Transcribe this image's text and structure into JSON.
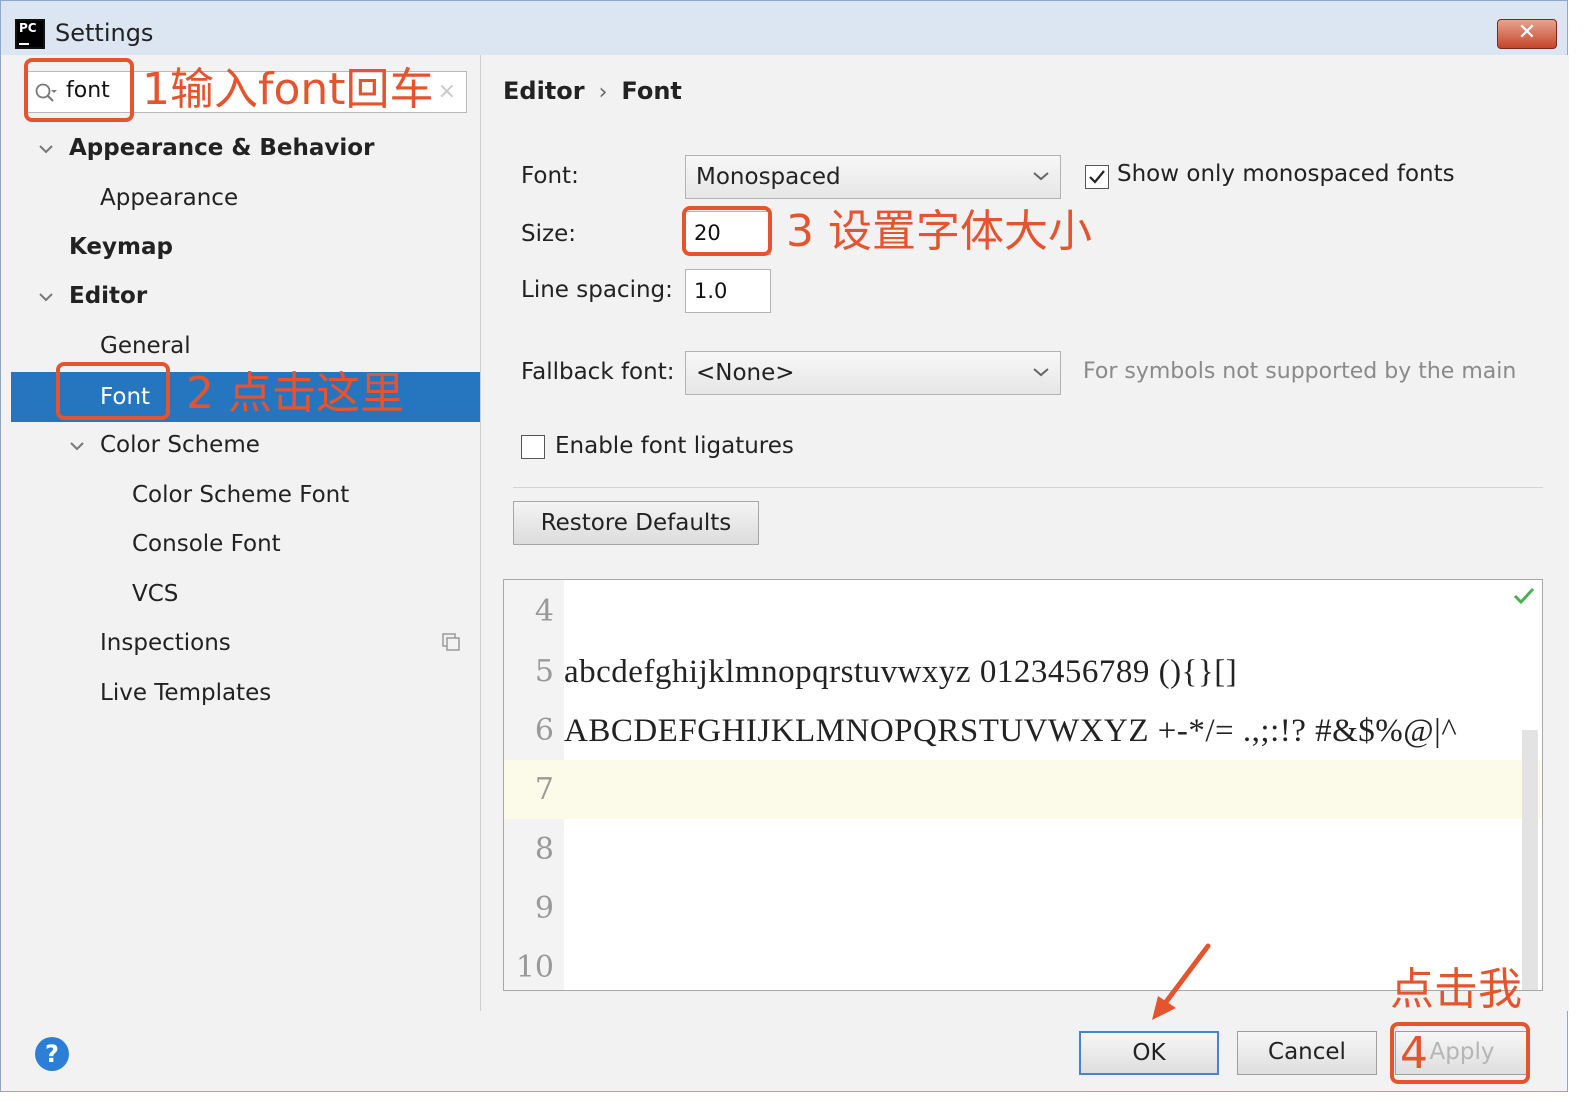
{
  "window": {
    "title": "Settings",
    "app_icon_text": "PC",
    "close_glyph": "✕"
  },
  "sidebar": {
    "search": {
      "value": "font",
      "clear_glyph": "×"
    },
    "items": [
      {
        "label": "Appearance & Behavior",
        "bold": true,
        "expanded": true
      },
      {
        "label": "Appearance"
      },
      {
        "label": "Keymap",
        "bold": true
      },
      {
        "label": "Editor",
        "bold": true,
        "expanded": true
      },
      {
        "label": "General"
      },
      {
        "label": "Font",
        "selected": true
      },
      {
        "label": "Color Scheme",
        "expanded": true
      },
      {
        "label": "Color Scheme Font"
      },
      {
        "label": "Console Font"
      },
      {
        "label": "VCS"
      },
      {
        "label": "Inspections"
      },
      {
        "label": "Live Templates"
      }
    ]
  },
  "breadcrumb": {
    "parent": "Editor",
    "separator": "›",
    "current": "Font"
  },
  "form": {
    "font_label": "Font:",
    "font_value": "Monospaced",
    "show_mono_label": "Show only monospaced fonts",
    "show_mono_checked": true,
    "size_label": "Size:",
    "size_value": "20",
    "line_spacing_label": "Line spacing:",
    "line_spacing_value": "1.0",
    "fallback_label": "Fallback font:",
    "fallback_value": "<None>",
    "fallback_hint": "For symbols not supported by the main",
    "ligatures_label": "Enable font ligatures",
    "ligatures_checked": false,
    "restore_label": "Restore Defaults"
  },
  "preview": {
    "lines": [
      {
        "num": "4",
        "text": ""
      },
      {
        "num": "5",
        "text": "abcdefghijklmnopqrstuvwxyz 0123456789 (){}[]"
      },
      {
        "num": "6",
        "text": "ABCDEFGHIJKLMNOPQRSTUVWXYZ +-*/= .,;:!? #&$%@|^"
      },
      {
        "num": "7",
        "text": "",
        "current": true
      },
      {
        "num": "8",
        "text": ""
      },
      {
        "num": "9",
        "text": ""
      },
      {
        "num": "10",
        "text": ""
      }
    ]
  },
  "footer": {
    "help": "?",
    "ok": "OK",
    "cancel": "Cancel",
    "apply": "Apply"
  },
  "annotations": {
    "step1": "1输入font回车",
    "step2": "2 点击这里",
    "step3": "3 设置字体大小",
    "step4": "4",
    "click_me": "点击我"
  },
  "colors": {
    "annotation": "#e4542e",
    "selection": "#2675bf",
    "accent": "#3f86d4"
  }
}
